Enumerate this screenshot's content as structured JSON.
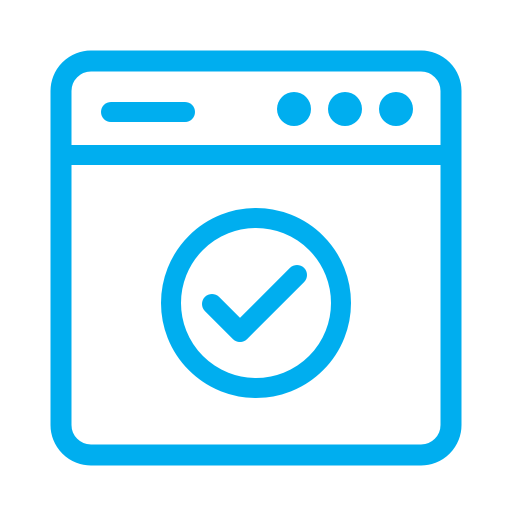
{
  "icon": {
    "name": "browser-window-check-icon",
    "accent_color": "#00AEEF",
    "background_color": "#FFFFFF",
    "parts": {
      "window": "browser-window-frame",
      "title_bar_line": "title-bar-placeholder",
      "window_controls": [
        "window-dot",
        "window-dot",
        "window-dot"
      ],
      "badge": "checkmark-in-circle"
    }
  }
}
